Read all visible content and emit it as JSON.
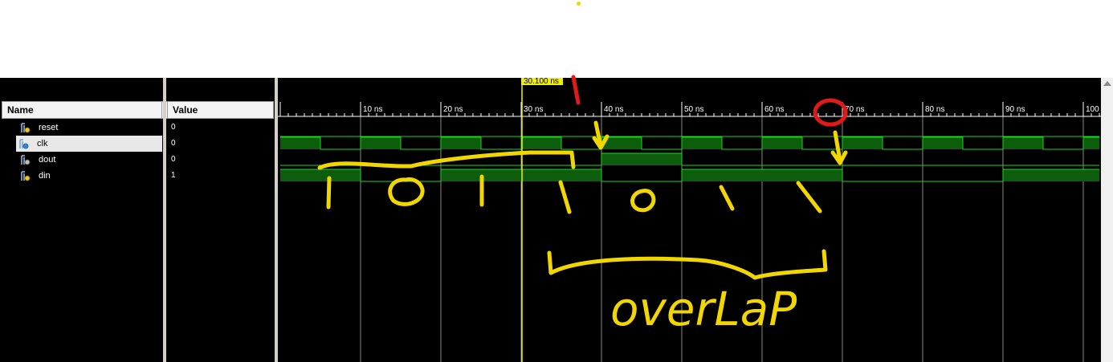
{
  "columns": {
    "name": "Name",
    "value": "Value"
  },
  "signals": [
    {
      "name": "reset",
      "value": "0",
      "icon": "bit-signal-icon"
    },
    {
      "name": "clk",
      "value": "0",
      "icon": "clock-signal-icon"
    },
    {
      "name": "dout",
      "value": "0",
      "icon": "output-signal-icon"
    },
    {
      "name": "din",
      "value": "1",
      "icon": "bit-signal-icon"
    }
  ],
  "cursor": {
    "label": "30.100 ns",
    "time_ns": 30.1
  },
  "timeline": {
    "unit": "ns",
    "major_ticks": [
      10,
      20,
      30,
      40,
      50,
      60,
      70,
      80,
      90,
      100
    ],
    "tick_labels": [
      "10 ns",
      "20 ns",
      "30 ns",
      "40 ns",
      "50 ns",
      "60 ns",
      "70 ns",
      "80 ns",
      "90 ns",
      "100 ns"
    ],
    "range_ns": [
      0,
      102
    ]
  },
  "waveforms": {
    "reset": [
      [
        0,
        0
      ]
    ],
    "clk": [
      [
        0,
        1
      ],
      [
        5,
        0
      ],
      [
        10,
        1
      ],
      [
        15,
        0
      ],
      [
        20,
        1
      ],
      [
        25,
        0
      ],
      [
        30,
        1
      ],
      [
        35,
        0
      ],
      [
        40,
        1
      ],
      [
        45,
        0
      ],
      [
        50,
        1
      ],
      [
        55,
        0
      ],
      [
        60,
        1
      ],
      [
        65,
        0
      ],
      [
        70,
        1
      ],
      [
        75,
        0
      ],
      [
        80,
        1
      ],
      [
        85,
        0
      ],
      [
        90,
        1
      ],
      [
        95,
        0
      ],
      [
        100,
        1
      ]
    ],
    "dout": [
      [
        0,
        0
      ],
      [
        40,
        1
      ],
      [
        50,
        0
      ]
    ],
    "din": [
      [
        0,
        1
      ],
      [
        10,
        0
      ],
      [
        20,
        1
      ],
      [
        40,
        0
      ],
      [
        50,
        1
      ],
      [
        70,
        0
      ],
      [
        90,
        1
      ]
    ]
  },
  "annotations": {
    "bit_labels": [
      "1",
      "0",
      "1",
      "1",
      "0",
      "1",
      "1"
    ],
    "overlap_text": "overLaP",
    "red_marker": "1",
    "colors": {
      "annotation_yellow": "#f2d600",
      "annotation_red": "#e01919",
      "wave_green": "#22d222",
      "wave_fill": "#0c5e0c",
      "cursor": "#f2f200"
    }
  }
}
